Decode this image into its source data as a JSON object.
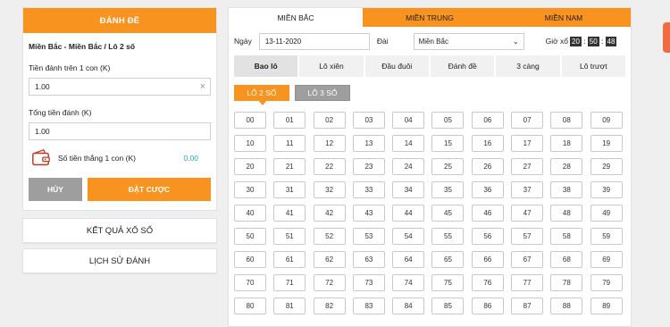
{
  "left_panel": {
    "header": "ĐÁNH ĐỀ",
    "bet_title": "Miền Bắc - Miền Bắc / Lô 2 số",
    "per_unit_label": "Tiền đánh trên 1 con (K)",
    "per_unit_value": "1.00",
    "total_label": "Tổng tiền đánh (K)",
    "total_value": "1.00",
    "win_label": "Số tiền thắng 1 con (K)",
    "win_value": "0.00",
    "cancel_label": "HỦY",
    "place_label": "ĐẶT CƯỢC",
    "results_label": "KẾT QUẢ XỔ SỐ",
    "history_label": "LỊCH SỬ ĐÁNH",
    "wallet_icon": "wallet-icon"
  },
  "region_tabs": [
    "MIỀN BẮC",
    "MIỀN TRUNG",
    "MIỀN NAM"
  ],
  "active_region": 0,
  "filters": {
    "date_label": "Ngày",
    "date_value": "13-11-2020",
    "dai_label": "Đài",
    "dai_value": "Miền Bắc",
    "time_label": "Giờ xổ",
    "hh": "20",
    "mm": "50",
    "ss": "48"
  },
  "game_tabs": [
    "Bao lô",
    "Lô xiên",
    "Đầu đuôi",
    "Đánh đề",
    "3 càng",
    "Lô trượt"
  ],
  "active_game": 0,
  "sub_tabs": [
    "LÔ 2 SỐ",
    "LÔ 3 SỐ"
  ],
  "active_sub": 0,
  "numbers": [
    "00",
    "01",
    "02",
    "03",
    "04",
    "05",
    "06",
    "07",
    "08",
    "09",
    "10",
    "11",
    "12",
    "13",
    "14",
    "15",
    "16",
    "17",
    "18",
    "19",
    "20",
    "21",
    "22",
    "23",
    "24",
    "25",
    "26",
    "27",
    "28",
    "29",
    "30",
    "31",
    "32",
    "33",
    "34",
    "35",
    "36",
    "37",
    "38",
    "39",
    "40",
    "41",
    "42",
    "43",
    "44",
    "45",
    "46",
    "47",
    "48",
    "49",
    "50",
    "51",
    "52",
    "53",
    "54",
    "55",
    "56",
    "57",
    "58",
    "59",
    "60",
    "61",
    "62",
    "63",
    "64",
    "65",
    "66",
    "67",
    "68",
    "69",
    "70",
    "71",
    "72",
    "73",
    "74",
    "75",
    "76",
    "77",
    "78",
    "79",
    "80",
    "81",
    "82",
    "83",
    "84",
    "85",
    "86",
    "87",
    "88",
    "89"
  ],
  "colors": {
    "accent": "#f7931e",
    "muted": "#9e9e9e",
    "teal": "#27a9b6"
  }
}
